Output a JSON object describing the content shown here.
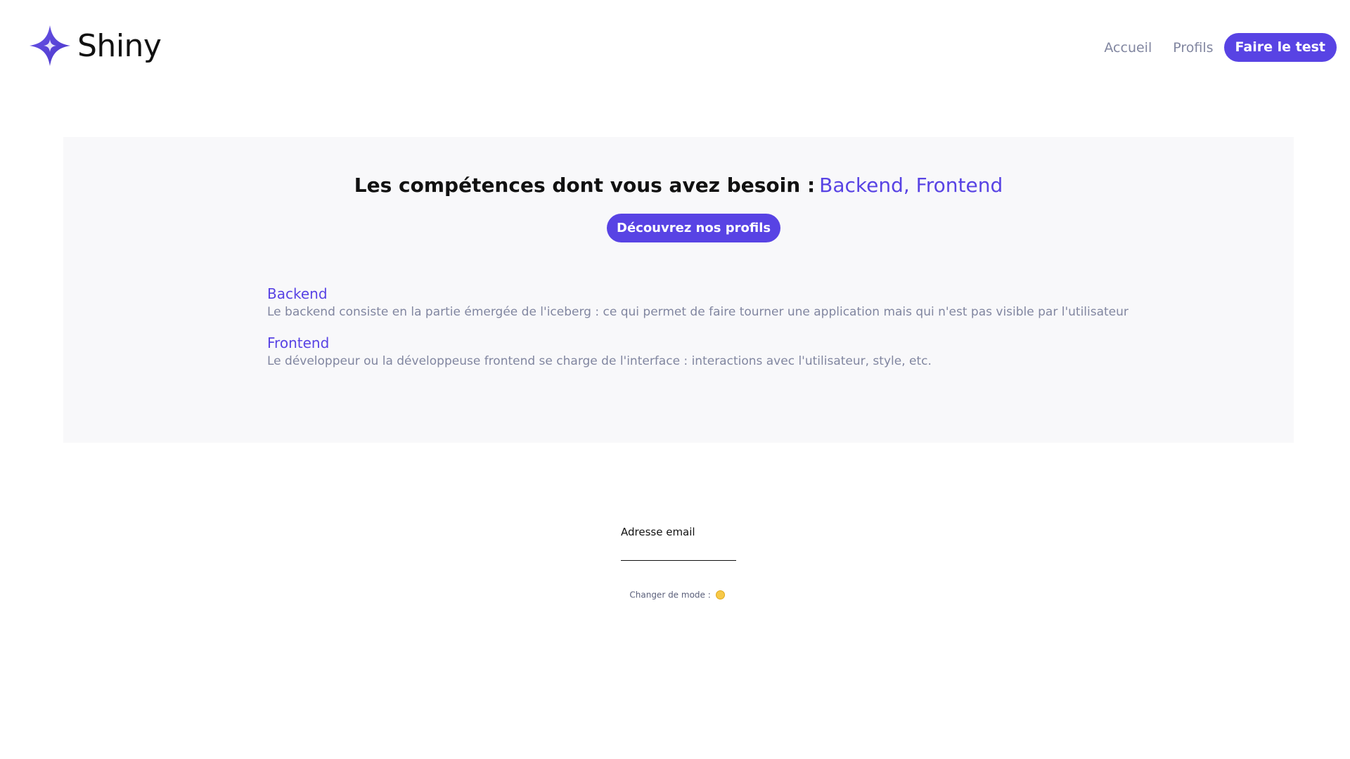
{
  "header": {
    "logo_text": "Shiny",
    "logo_icon": "sparkle-star-icon",
    "nav": {
      "home_label": "Accueil",
      "profiles_label": "Profils",
      "test_label": "Faire le test"
    }
  },
  "results": {
    "title_prefix": "Les compétences dont vous avez besoin :",
    "title_skills": "Backend, Frontend",
    "discover_button": "Découvrez nos profils",
    "skills": [
      {
        "name": "Backend",
        "description": "Le backend consiste en la partie émergée de l'iceberg : ce qui permet de faire tourner une application mais qui n'est pas visible par l'utilisateur"
      },
      {
        "name": "Frontend",
        "description": "Le développeur ou la développeuse frontend se charge de l'interface : interactions avec l'utilisateur, style, etc."
      }
    ]
  },
  "email": {
    "label": "Adresse email",
    "value": ""
  },
  "theme": {
    "toggle_label": "Changer de mode :",
    "toggle_icon": "sun-icon"
  },
  "colors": {
    "accent": "#5843e4",
    "muted_text": "#8186a0",
    "panel_background": "#f8f8fa"
  }
}
